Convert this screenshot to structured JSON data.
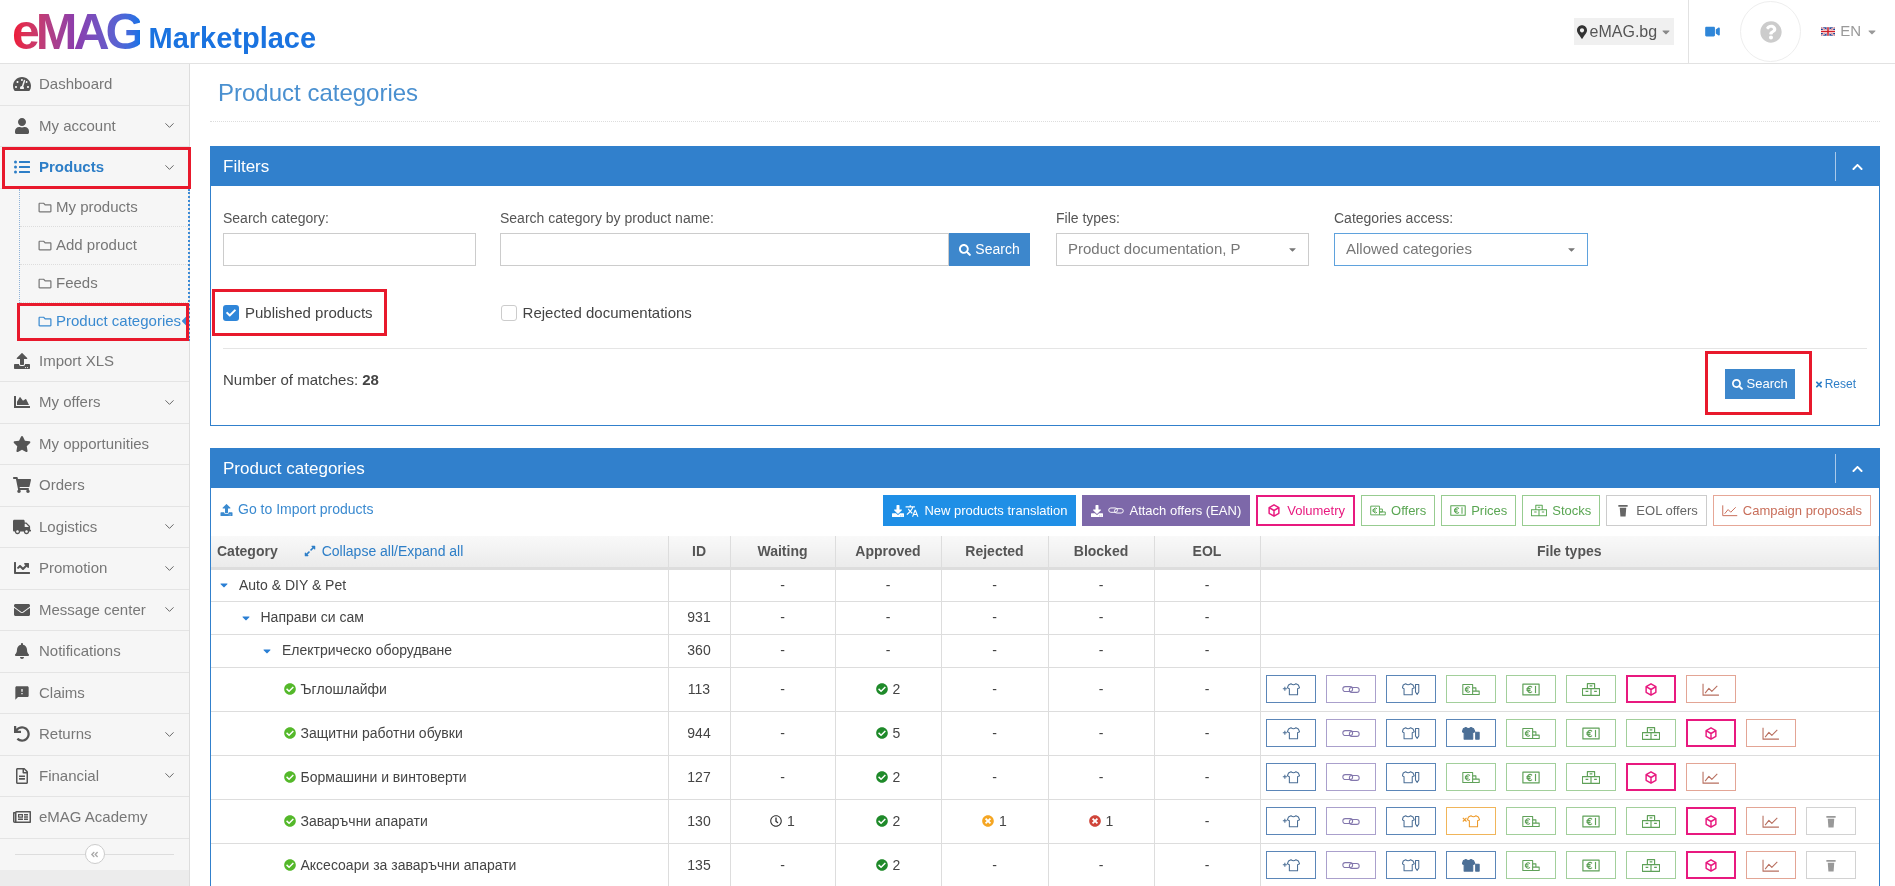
{
  "header": {
    "logo": {
      "brand": "eMAG",
      "product": "Marketplace"
    },
    "site": "eMAG.bg",
    "language": "EN"
  },
  "sidebar": {
    "items": [
      {
        "label": "Dashboard",
        "has_submenu": false,
        "selected": false,
        "highlighted": false
      },
      {
        "label": "My account",
        "has_submenu": true,
        "selected": false,
        "highlighted": false
      },
      {
        "label": "Products",
        "has_submenu": true,
        "selected": true,
        "highlighted": true,
        "children": [
          {
            "label": "My products",
            "selected": false,
            "highlighted": false
          },
          {
            "label": "Add product",
            "selected": false,
            "highlighted": false
          },
          {
            "label": "Feeds",
            "selected": false,
            "highlighted": false
          },
          {
            "label": "Product categories",
            "selected": true,
            "highlighted": true
          }
        ]
      },
      {
        "label": "Import XLS",
        "has_submenu": false,
        "selected": false,
        "highlighted": false
      },
      {
        "label": "My offers",
        "has_submenu": true,
        "selected": false,
        "highlighted": false
      },
      {
        "label": "My opportunities",
        "has_submenu": false,
        "selected": false,
        "highlighted": false
      },
      {
        "label": "Orders",
        "has_submenu": false,
        "selected": false,
        "highlighted": false
      },
      {
        "label": "Logistics",
        "has_submenu": true,
        "selected": false,
        "highlighted": false
      },
      {
        "label": "Promotion",
        "has_submenu": true,
        "selected": false,
        "highlighted": false
      },
      {
        "label": "Message center",
        "has_submenu": true,
        "selected": false,
        "highlighted": false
      },
      {
        "label": "Notifications",
        "has_submenu": false,
        "selected": false,
        "highlighted": false
      },
      {
        "label": "Claims",
        "has_submenu": false,
        "selected": false,
        "highlighted": false
      },
      {
        "label": "Returns",
        "has_submenu": true,
        "selected": false,
        "highlighted": false
      },
      {
        "label": "Financial",
        "has_submenu": true,
        "selected": false,
        "highlighted": false
      },
      {
        "label": "eMAG Academy",
        "has_submenu": false,
        "selected": false,
        "highlighted": false
      }
    ]
  },
  "page_title": "Product categories",
  "filters": {
    "title": "Filters",
    "fields": [
      {
        "label": "Search category:",
        "kind": "text",
        "focused": false
      },
      {
        "label": "Search category by product name:",
        "kind": "search",
        "button": "Search",
        "focused": false
      },
      {
        "label": "File types:",
        "kind": "select",
        "value": "Product documentation, P",
        "focused": false
      },
      {
        "label": "Categories access:",
        "kind": "select",
        "value": "Allowed categories",
        "focused": true
      }
    ],
    "checkboxes": [
      {
        "label": "Published products",
        "checked": true,
        "highlighted": true
      },
      {
        "label": "Rejected documentations",
        "checked": false,
        "highlighted": false
      }
    ],
    "matches": "Number of matches: **28**",
    "search_button": {
      "label": "Search",
      "highlighted": true
    },
    "reset": "Reset"
  },
  "categories_panel": {
    "title": "Product categories",
    "import_link": "Go to Import products",
    "actions": [
      {
        "label": "New products translation",
        "kind": "translation"
      },
      {
        "label": "Attach offers (EAN)",
        "kind": "attach"
      },
      {
        "label": "Volumetry",
        "kind": "volumetry"
      },
      {
        "label": "Offers",
        "kind": "offers"
      },
      {
        "label": "Prices",
        "kind": "prices"
      },
      {
        "label": "Stocks",
        "kind": "stocks"
      },
      {
        "label": "EOL offers",
        "kind": "eol"
      },
      {
        "label": "Campaign proposals",
        "kind": "campaign"
      }
    ],
    "table": {
      "columns": [
        "Category",
        "ID",
        "Waiting",
        "Approved",
        "Rejected",
        "Blocked",
        "EOL",
        "File types"
      ],
      "collapse_link": "Collapse all/Expand all",
      "rows": [
        {
          "name": "Auto & DIY & Pet",
          "expanded": true,
          "counts": [
            {
              "kind": "plain",
              "text": "-"
            },
            {
              "kind": "plain",
              "text": "-"
            },
            {
              "kind": "plain",
              "text": "-"
            },
            {
              "kind": "plain",
              "text": "-"
            },
            {
              "kind": "plain",
              "text": "-"
            }
          ],
          "children": [
            {
              "name": "Направи си сам",
              "id": "931",
              "expanded": true,
              "counts": [
                {
                  "kind": "plain",
                  "text": "-"
                },
                {
                  "kind": "plain",
                  "text": "-"
                },
                {
                  "kind": "plain",
                  "text": "-"
                },
                {
                  "kind": "plain",
                  "text": "-"
                },
                {
                  "kind": "plain",
                  "text": "-"
                }
              ],
              "children": [
                {
                  "name": "Електрическо оборудване",
                  "id": "360",
                  "expanded": true,
                  "counts": [
                    {
                      "kind": "plain",
                      "text": "-"
                    },
                    {
                      "kind": "plain",
                      "text": "-"
                    },
                    {
                      "kind": "plain",
                      "text": "-"
                    },
                    {
                      "kind": "plain",
                      "text": "-"
                    },
                    {
                      "kind": "plain",
                      "text": "-"
                    }
                  ],
                  "children": [
                    {
                      "name": "Ъглошлайфи",
                      "id": "113",
                      "allowed": true,
                      "counts": [
                        {
                          "kind": "plain",
                          "text": "-"
                        },
                        {
                          "kind": "approved",
                          "text": "2"
                        },
                        {
                          "kind": "plain",
                          "text": "-"
                        },
                        {
                          "kind": "plain",
                          "text": "-"
                        },
                        {
                          "kind": "plain",
                          "text": "-"
                        }
                      ],
                      "file_types": [
                        {
                          "kind": "add"
                        },
                        {
                          "kind": "attach"
                        },
                        {
                          "kind": "docs"
                        },
                        {
                          "kind": "offers"
                        },
                        {
                          "kind": "prices"
                        },
                        {
                          "kind": "stocks"
                        },
                        {
                          "kind": "volumetry"
                        },
                        {
                          "kind": "campaign"
                        }
                      ]
                    },
                    {
                      "name": "Защитни работни обувки",
                      "id": "944",
                      "allowed": true,
                      "counts": [
                        {
                          "kind": "plain",
                          "text": "-"
                        },
                        {
                          "kind": "approved",
                          "text": "5"
                        },
                        {
                          "kind": "plain",
                          "text": "-"
                        },
                        {
                          "kind": "plain",
                          "text": "-"
                        },
                        {
                          "kind": "plain",
                          "text": "-"
                        }
                      ],
                      "file_types": [
                        {
                          "kind": "add"
                        },
                        {
                          "kind": "attach"
                        },
                        {
                          "kind": "docs"
                        },
                        {
                          "kind": "shirt"
                        },
                        {
                          "kind": "offers"
                        },
                        {
                          "kind": "prices"
                        },
                        {
                          "kind": "stocks"
                        },
                        {
                          "kind": "volumetry"
                        },
                        {
                          "kind": "campaign"
                        }
                      ]
                    },
                    {
                      "name": "Бормашини и винтоверти",
                      "id": "127",
                      "allowed": true,
                      "counts": [
                        {
                          "kind": "plain",
                          "text": "-"
                        },
                        {
                          "kind": "approved",
                          "text": "2"
                        },
                        {
                          "kind": "plain",
                          "text": "-"
                        },
                        {
                          "kind": "plain",
                          "text": "-"
                        },
                        {
                          "kind": "plain",
                          "text": "-"
                        }
                      ],
                      "file_types": [
                        {
                          "kind": "add"
                        },
                        {
                          "kind": "attach"
                        },
                        {
                          "kind": "docs"
                        },
                        {
                          "kind": "offers"
                        },
                        {
                          "kind": "prices"
                        },
                        {
                          "kind": "stocks"
                        },
                        {
                          "kind": "volumetry"
                        },
                        {
                          "kind": "campaign"
                        }
                      ]
                    },
                    {
                      "name": "Заваръчни апарати",
                      "id": "130",
                      "allowed": true,
                      "counts": [
                        {
                          "kind": "waiting",
                          "text": "1"
                        },
                        {
                          "kind": "approved",
                          "text": "2"
                        },
                        {
                          "kind": "rejected",
                          "text": "1"
                        },
                        {
                          "kind": "blocked",
                          "text": "1"
                        },
                        {
                          "kind": "plain",
                          "text": "-"
                        }
                      ],
                      "file_types": [
                        {
                          "kind": "add"
                        },
                        {
                          "kind": "attach"
                        },
                        {
                          "kind": "docs"
                        },
                        {
                          "kind": "refused"
                        },
                        {
                          "kind": "offers"
                        },
                        {
                          "kind": "prices"
                        },
                        {
                          "kind": "stocks"
                        },
                        {
                          "kind": "volumetry"
                        },
                        {
                          "kind": "campaign"
                        },
                        {
                          "kind": "eol"
                        }
                      ]
                    },
                    {
                      "name": "Аксесоари за заваръчни апарати",
                      "id": "135",
                      "allowed": true,
                      "counts": [
                        {
                          "kind": "plain",
                          "text": "-"
                        },
                        {
                          "kind": "approved",
                          "text": "2"
                        },
                        {
                          "kind": "plain",
                          "text": "-"
                        },
                        {
                          "kind": "plain",
                          "text": "-"
                        },
                        {
                          "kind": "plain",
                          "text": "-"
                        }
                      ],
                      "file_types": [
                        {
                          "kind": "add"
                        },
                        {
                          "kind": "attach"
                        },
                        {
                          "kind": "docs"
                        },
                        {
                          "kind": "shirt"
                        },
                        {
                          "kind": "offers"
                        },
                        {
                          "kind": "prices"
                        },
                        {
                          "kind": "stocks"
                        },
                        {
                          "kind": "volumetry"
                        },
                        {
                          "kind": "campaign"
                        },
                        {
                          "kind": "eol"
                        }
                      ]
                    }
                  ]
                }
              ]
            }
          ]
        }
      ]
    }
  }
}
